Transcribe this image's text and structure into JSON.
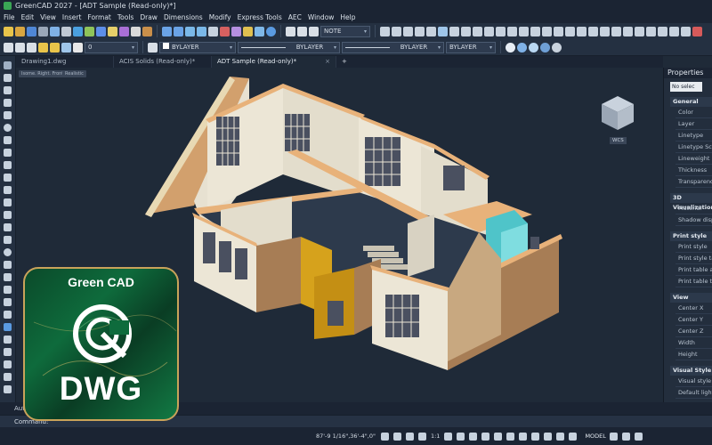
{
  "app": {
    "title": "GreenCAD 2027 - [ADT Sample (Read-only)*]"
  },
  "menu": [
    "File",
    "Edit",
    "View",
    "Insert",
    "Format",
    "Tools",
    "Draw",
    "Dimensions",
    "Modify",
    "Express Tools",
    "AEC",
    "Window",
    "Help"
  ],
  "toolbar1": {
    "text_style": "NOTE"
  },
  "toolbar2": {
    "layer": "0",
    "color": "BYLAYER",
    "linetype": "BYLAYER",
    "lineweight": "BYLAYER",
    "plotstyle": "BYLAYER"
  },
  "tabs": [
    {
      "label": "Drawing1.dwg",
      "active": false
    },
    {
      "label": "ACIS Solids (Read-only)*",
      "active": false
    },
    {
      "label": "ADT Sample (Read-only)*",
      "active": true
    }
  ],
  "tab_plus": "+",
  "viewport": {
    "view_label": "Isome. Right. Front",
    "style_label": "Realistic",
    "wcs": "WCS"
  },
  "properties": {
    "title": "Properties",
    "selection": "No selec",
    "sections": [
      {
        "name": "General",
        "rows": [
          "Color",
          "Layer",
          "Linetype",
          "Linetype Scale",
          "Lineweight",
          "Thickness",
          "Transparency"
        ]
      },
      {
        "name": "3D Visualization",
        "rows": [
          "Material",
          "Shadow display"
        ]
      },
      {
        "name": "Print style",
        "rows": [
          "Print style",
          "Print style table",
          "Print table attached",
          "Print table type"
        ]
      },
      {
        "name": "View",
        "rows": [
          "Center X",
          "Center Y",
          "Center Z",
          "Width",
          "Height"
        ]
      },
      {
        "name": "Visual Style",
        "rows": [
          "Visual style",
          "Default lighting"
        ]
      }
    ]
  },
  "command": {
    "tab": "Auto",
    "prompt": "Command:"
  },
  "status": {
    "coords": "87'-9 1/16\",36'-4\",0\"",
    "model": "MODEL",
    "scale": "1:1"
  },
  "badge": {
    "line1": "Green CAD",
    "line2": "DWG"
  },
  "colors": {
    "accent_green": "#0e6b3c",
    "badge_border": "#c9a35a",
    "wall_cream": "#ece6d6",
    "wall_top": "#e8b27a",
    "brick": "#a77d55",
    "panel_yellow": "#d6a21c",
    "glass_cyan": "#4fc4c9"
  }
}
